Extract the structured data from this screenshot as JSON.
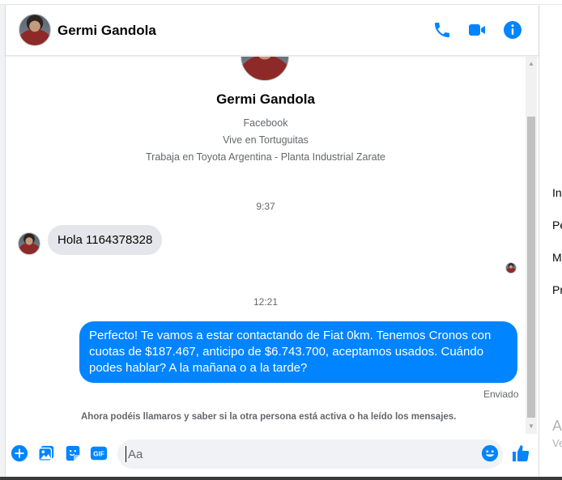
{
  "contact": {
    "name": "Germi Gandola",
    "profile_lines": [
      "Facebook",
      "Vive en Tortuguitas",
      "Trabaja en Toyota Argentina - Planta Industrial Zarate"
    ]
  },
  "header": {
    "icons": [
      "phone-icon",
      "video-camera-icon",
      "info-icon"
    ]
  },
  "conversation": {
    "timestamp_1": "9:37",
    "incoming_message": "Hola 1164378328",
    "timestamp_2": "12:21",
    "outgoing_message": "Perfecto! Te vamos a estar contactando de Fiat 0km. Tenemos Cronos con cuotas de $187.467, anticipo de $6.743.700, aceptamos usados. Cuándo podes hablar? A la mañana o a la tarde?",
    "sent_status": "Enviado",
    "notice": "Ahora podéis llamaros y saber si la otra persona está activa o ha leído los mensajes."
  },
  "composer": {
    "placeholder": "Aa",
    "gif_label": "GIF",
    "icons": [
      "plus-icon",
      "photo-icon",
      "sticker-icon",
      "gif-icon",
      "emoji-icon",
      "thumbs-up-icon"
    ]
  },
  "side_panel": {
    "items": [
      "In",
      "Pe",
      "M",
      "Pr"
    ],
    "muted": [
      "A",
      "Ve"
    ]
  },
  "colors": {
    "accent": "#0084ff",
    "incoming_bubble": "#e4e6eb",
    "secondary_text": "#65676b"
  }
}
